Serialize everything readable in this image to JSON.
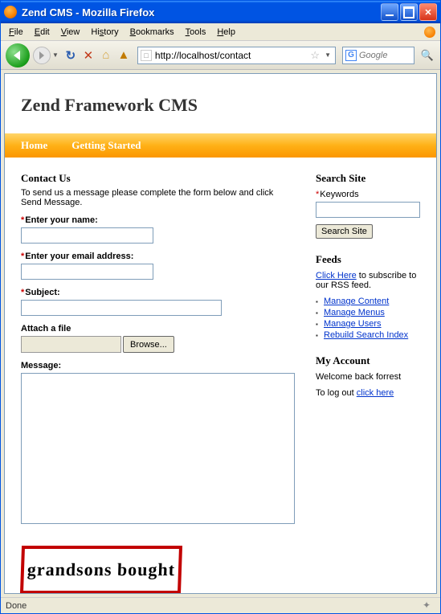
{
  "window": {
    "title": "Zend CMS - Mozilla Firefox"
  },
  "menubar": {
    "file": "File",
    "edit": "Edit",
    "view": "View",
    "history": "History",
    "bookmarks": "Bookmarks",
    "tools": "Tools",
    "help": "Help"
  },
  "toolbar": {
    "url": "http://localhost/contact",
    "search_placeholder": "Google"
  },
  "page": {
    "brand": "Zend Framework CMS",
    "nav": {
      "home": "Home",
      "getting_started": "Getting Started"
    },
    "main": {
      "heading": "Contact Us",
      "intro": "To send us a message please complete the form below and click Send Message.",
      "labels": {
        "name": "Enter your name:",
        "email": "Enter your email address:",
        "subject": "Subject:",
        "attach": "Attach a file",
        "browse": "Browse...",
        "message": "Message:"
      },
      "captcha": "grandsons bought"
    },
    "sidebar": {
      "search": {
        "title": "Search Site",
        "label": "Keywords",
        "button": "Search Site"
      },
      "feeds": {
        "title": "Feeds",
        "link": "Click Here",
        "text": " to subscribe to our RSS feed."
      },
      "admin": {
        "items": [
          {
            "label": "Manage Content"
          },
          {
            "label": "Manage Menus"
          },
          {
            "label": "Manage Users"
          },
          {
            "label": "Rebuild Search Index"
          }
        ]
      },
      "account": {
        "title": "My Account",
        "welcome": "Welcome back forrest",
        "logout_prefix": "To log out ",
        "logout_link": "click here"
      }
    }
  },
  "statusbar": {
    "text": "Done"
  }
}
